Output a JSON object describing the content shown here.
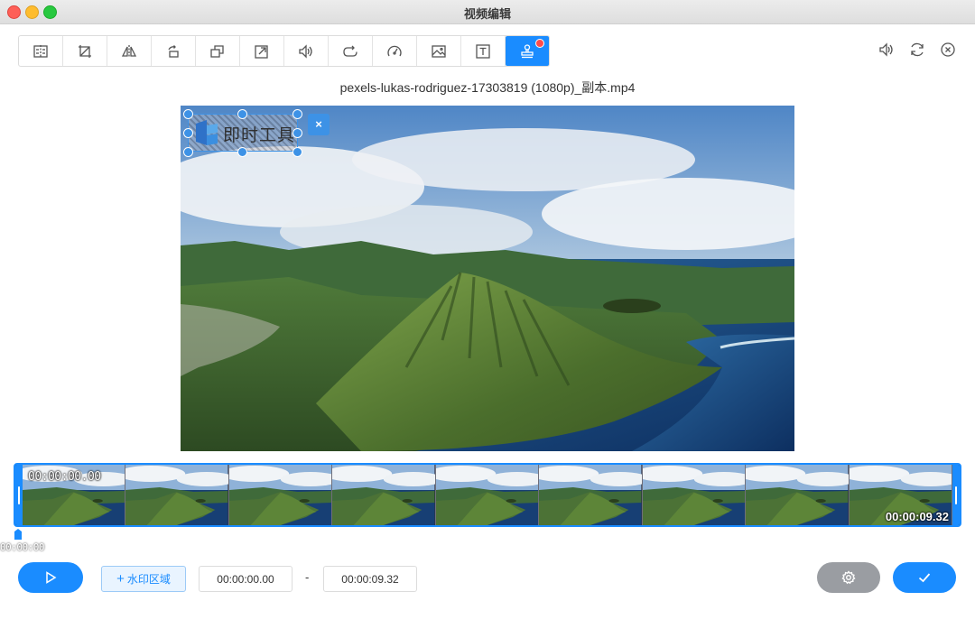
{
  "window": {
    "title": "视频编辑"
  },
  "toolbar": {
    "tools": [
      {
        "icon": "split-icon"
      },
      {
        "icon": "crop-icon"
      },
      {
        "icon": "flip-icon"
      },
      {
        "icon": "rotate-icon"
      },
      {
        "icon": "resize-icon"
      },
      {
        "icon": "export-icon"
      },
      {
        "icon": "volume-icon"
      },
      {
        "icon": "loop-icon"
      },
      {
        "icon": "speed-icon"
      },
      {
        "icon": "image-icon"
      },
      {
        "icon": "text-icon"
      },
      {
        "icon": "watermark-stamp-icon",
        "active": true,
        "badge": true
      }
    ],
    "accent": "#1a8cff"
  },
  "right_icons": [
    "volume-icon",
    "refresh-icon",
    "close-circle-icon"
  ],
  "file": {
    "name": "pexels-lukas-rodriguez-17303819 (1080p)_副本.mp4"
  },
  "watermark": {
    "text": "即时工具",
    "close_label": "×"
  },
  "timeline": {
    "start_label": "00:00:00.00",
    "end_label": "00:00:09.32",
    "playhead_label": "00:00:00",
    "frame_count": 9
  },
  "controls": {
    "watermark_area_plus": "+",
    "watermark_area_label": "水印区域",
    "start_time": "00:00:00.00",
    "separator": "-",
    "end_time": "00:00:09.32"
  }
}
